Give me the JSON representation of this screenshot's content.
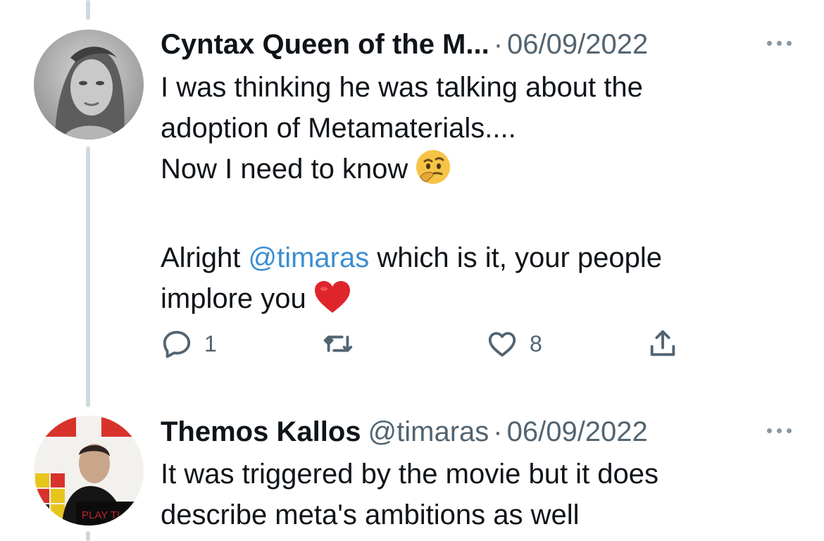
{
  "tweets": [
    {
      "name": "Cyntax Queen of the M...",
      "handle": "",
      "separator": "·",
      "date": "06/09/2022",
      "lines": [
        "I was thinking he was talking about the",
        "adoption of Metamaterials....",
        "Now I need to know"
      ],
      "mention_prefix": "Alright ",
      "mention": "@timaras",
      "mention_suffix": " which is it, your people",
      "last_line": "implore you",
      "thinking_emoji": "🤔",
      "heart_emoji": "❤️",
      "actions": {
        "reply_count": "1",
        "retweet_count": "",
        "like_count": "8"
      },
      "icons": [
        "reply-icon",
        "retweet-icon",
        "like-icon",
        "share-icon",
        "more-icon"
      ]
    },
    {
      "name": "Themos Kallos",
      "handle": "@timaras",
      "separator": "·",
      "date": "06/09/2022",
      "lines": [
        "It was triggered by the movie but it does",
        "describe meta's ambitions as well"
      ],
      "avatar_caption": "PLAY TI"
    }
  ],
  "colors": {
    "text": "#0f1419",
    "secondary": "#536471",
    "mention": "#3b8ed3",
    "thread_line": "#cfd9de"
  }
}
